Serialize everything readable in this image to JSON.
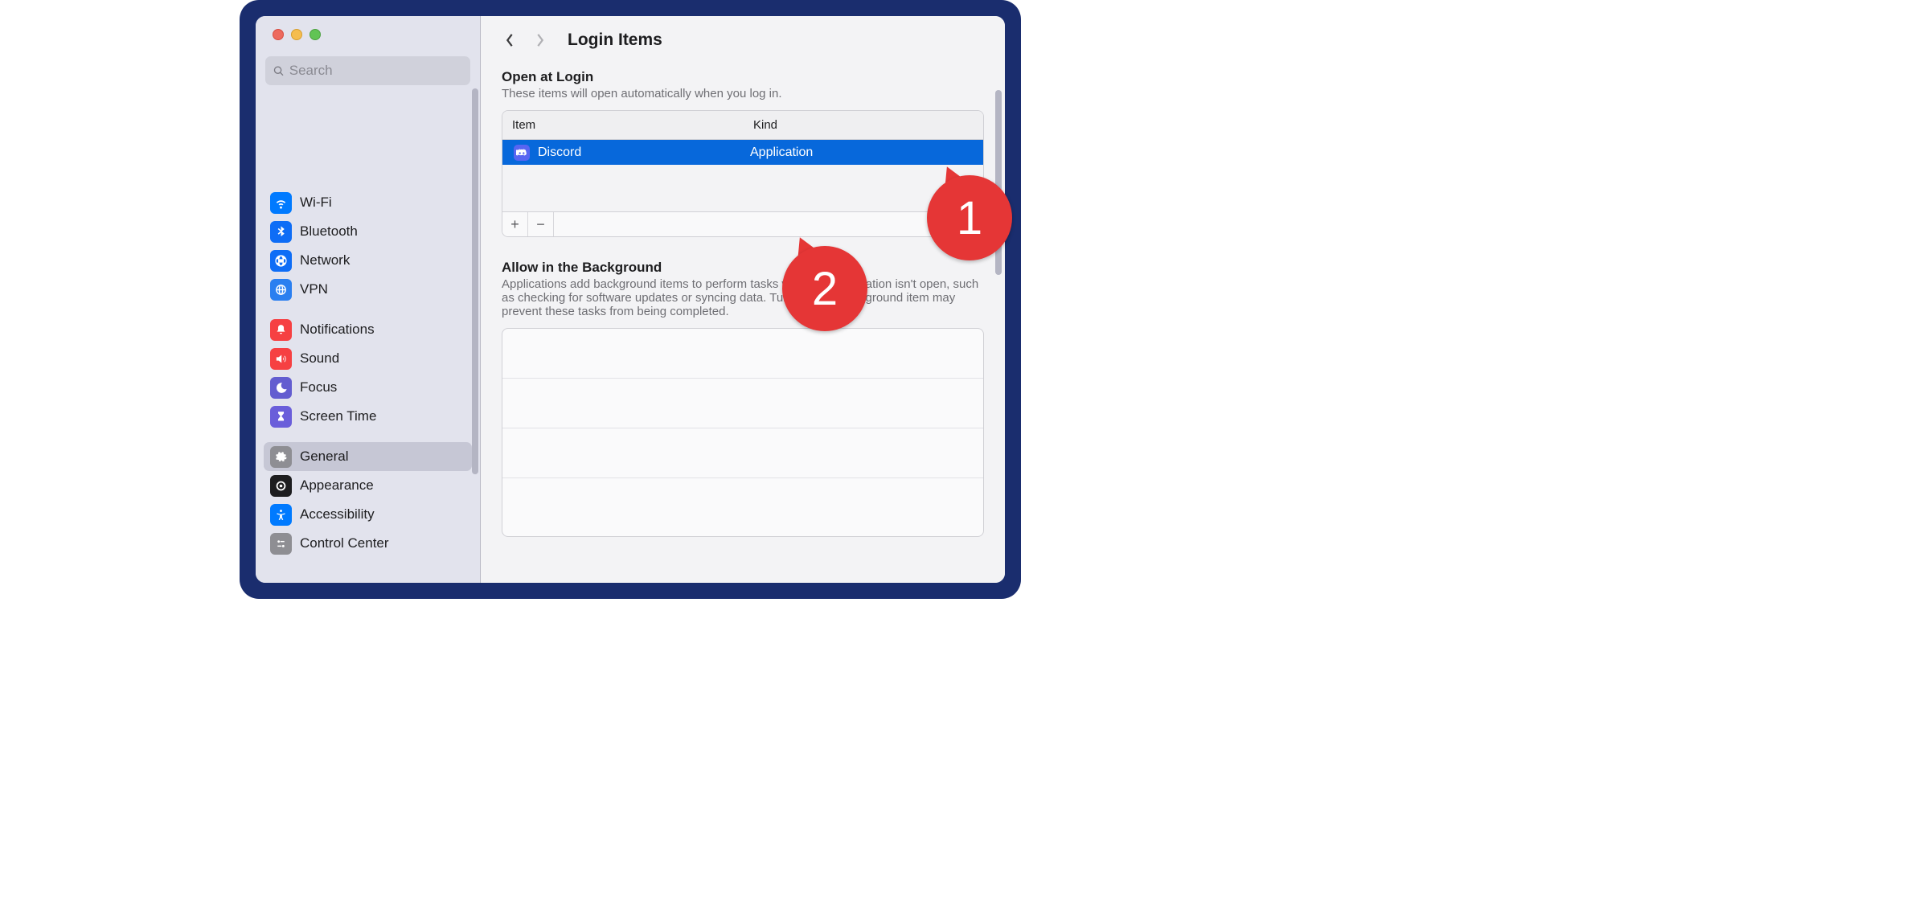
{
  "search": {
    "placeholder": "Search"
  },
  "sidebar": {
    "groups": [
      {
        "items": [
          {
            "label": "Wi-Fi"
          },
          {
            "label": "Bluetooth"
          },
          {
            "label": "Network"
          },
          {
            "label": "VPN"
          }
        ]
      },
      {
        "items": [
          {
            "label": "Notifications"
          },
          {
            "label": "Sound"
          },
          {
            "label": "Focus"
          },
          {
            "label": "Screen Time"
          }
        ]
      },
      {
        "items": [
          {
            "label": "General"
          },
          {
            "label": "Appearance"
          },
          {
            "label": "Accessibility"
          },
          {
            "label": "Control Center"
          }
        ]
      }
    ]
  },
  "header": {
    "title": "Login Items"
  },
  "open_at_login": {
    "title": "Open at Login",
    "description": "These items will open automatically when you log in.",
    "columns": {
      "item": "Item",
      "kind": "Kind"
    },
    "rows": [
      {
        "name": "Discord",
        "kind": "Application"
      }
    ],
    "add": "+",
    "remove": "−"
  },
  "background": {
    "title": "Allow in the Background",
    "description": "Applications add background items to perform tasks when the application isn't open, such as checking for software updates or syncing data. Turning off a background item may prevent these tasks from being completed."
  },
  "callouts": {
    "one": "1",
    "two": "2"
  }
}
